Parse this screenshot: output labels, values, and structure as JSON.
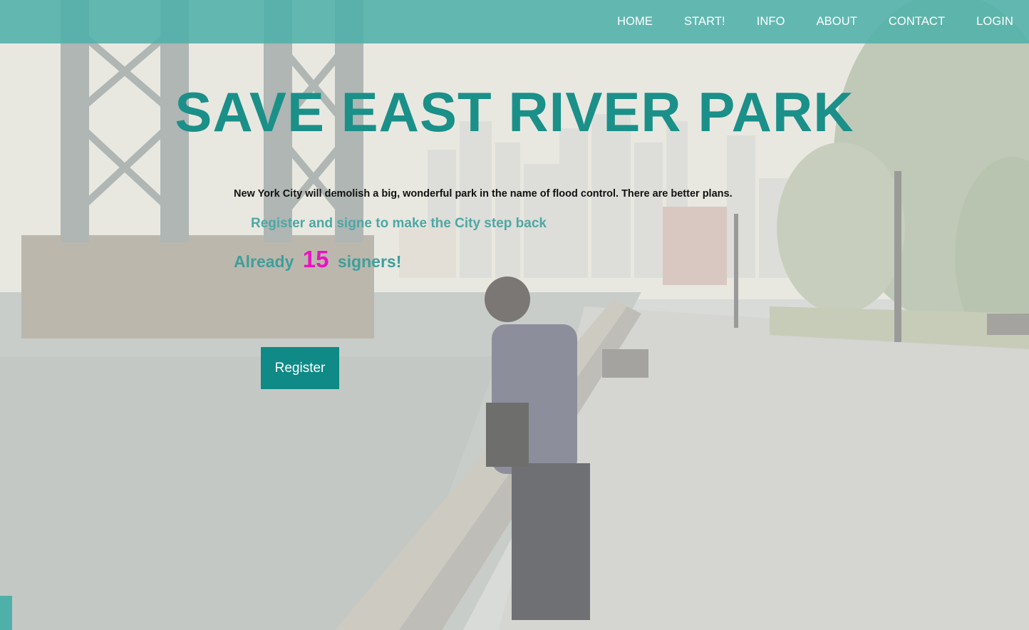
{
  "nav": {
    "items": [
      {
        "label": "HOME"
      },
      {
        "label": "START!"
      },
      {
        "label": "INFO"
      },
      {
        "label": "ABOUT"
      },
      {
        "label": "CONTACT"
      },
      {
        "label": "LOGIN"
      }
    ]
  },
  "hero": {
    "title": "SAVE EAST RIVER PARK",
    "tagline": "New York City will demolish a big, wonderful park in the name of flood control. There are better plans.",
    "cta_text": "Register and signe to make the City step back",
    "signers_prefix": "Already",
    "signers_count": "15",
    "signers_suffix": "signers!",
    "register_label": "Register"
  },
  "colors": {
    "nav_bg": "#4fb0aa",
    "title": "#1a9089",
    "count_accent": "#ec12c3",
    "button_bg": "#0f8a86"
  }
}
